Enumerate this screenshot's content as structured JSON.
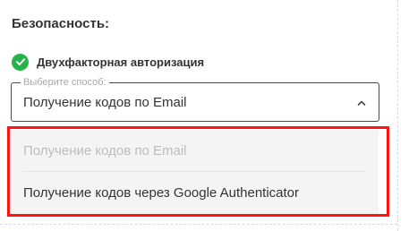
{
  "section": {
    "title": "Безопасность:"
  },
  "two_factor": {
    "label": "Двухфакторная авторизация",
    "enabled": true,
    "icon": "check-circle-icon"
  },
  "select": {
    "legend": "Выберите способ:",
    "value": "Получение кодов по Email",
    "expanded": true,
    "toggle_icon": "chevron-up-icon"
  },
  "dropdown": {
    "options": [
      {
        "label": "Получение кодов по Email",
        "selected": true
      },
      {
        "label": "Получение кодов через Google Authenticator",
        "selected": false
      }
    ]
  },
  "colors": {
    "accent_green": "#25b34a",
    "highlight_red": "#ff1414",
    "text": "#333333",
    "muted": "#a8a8a8",
    "dropdown_bg": "#f4f4f4"
  }
}
